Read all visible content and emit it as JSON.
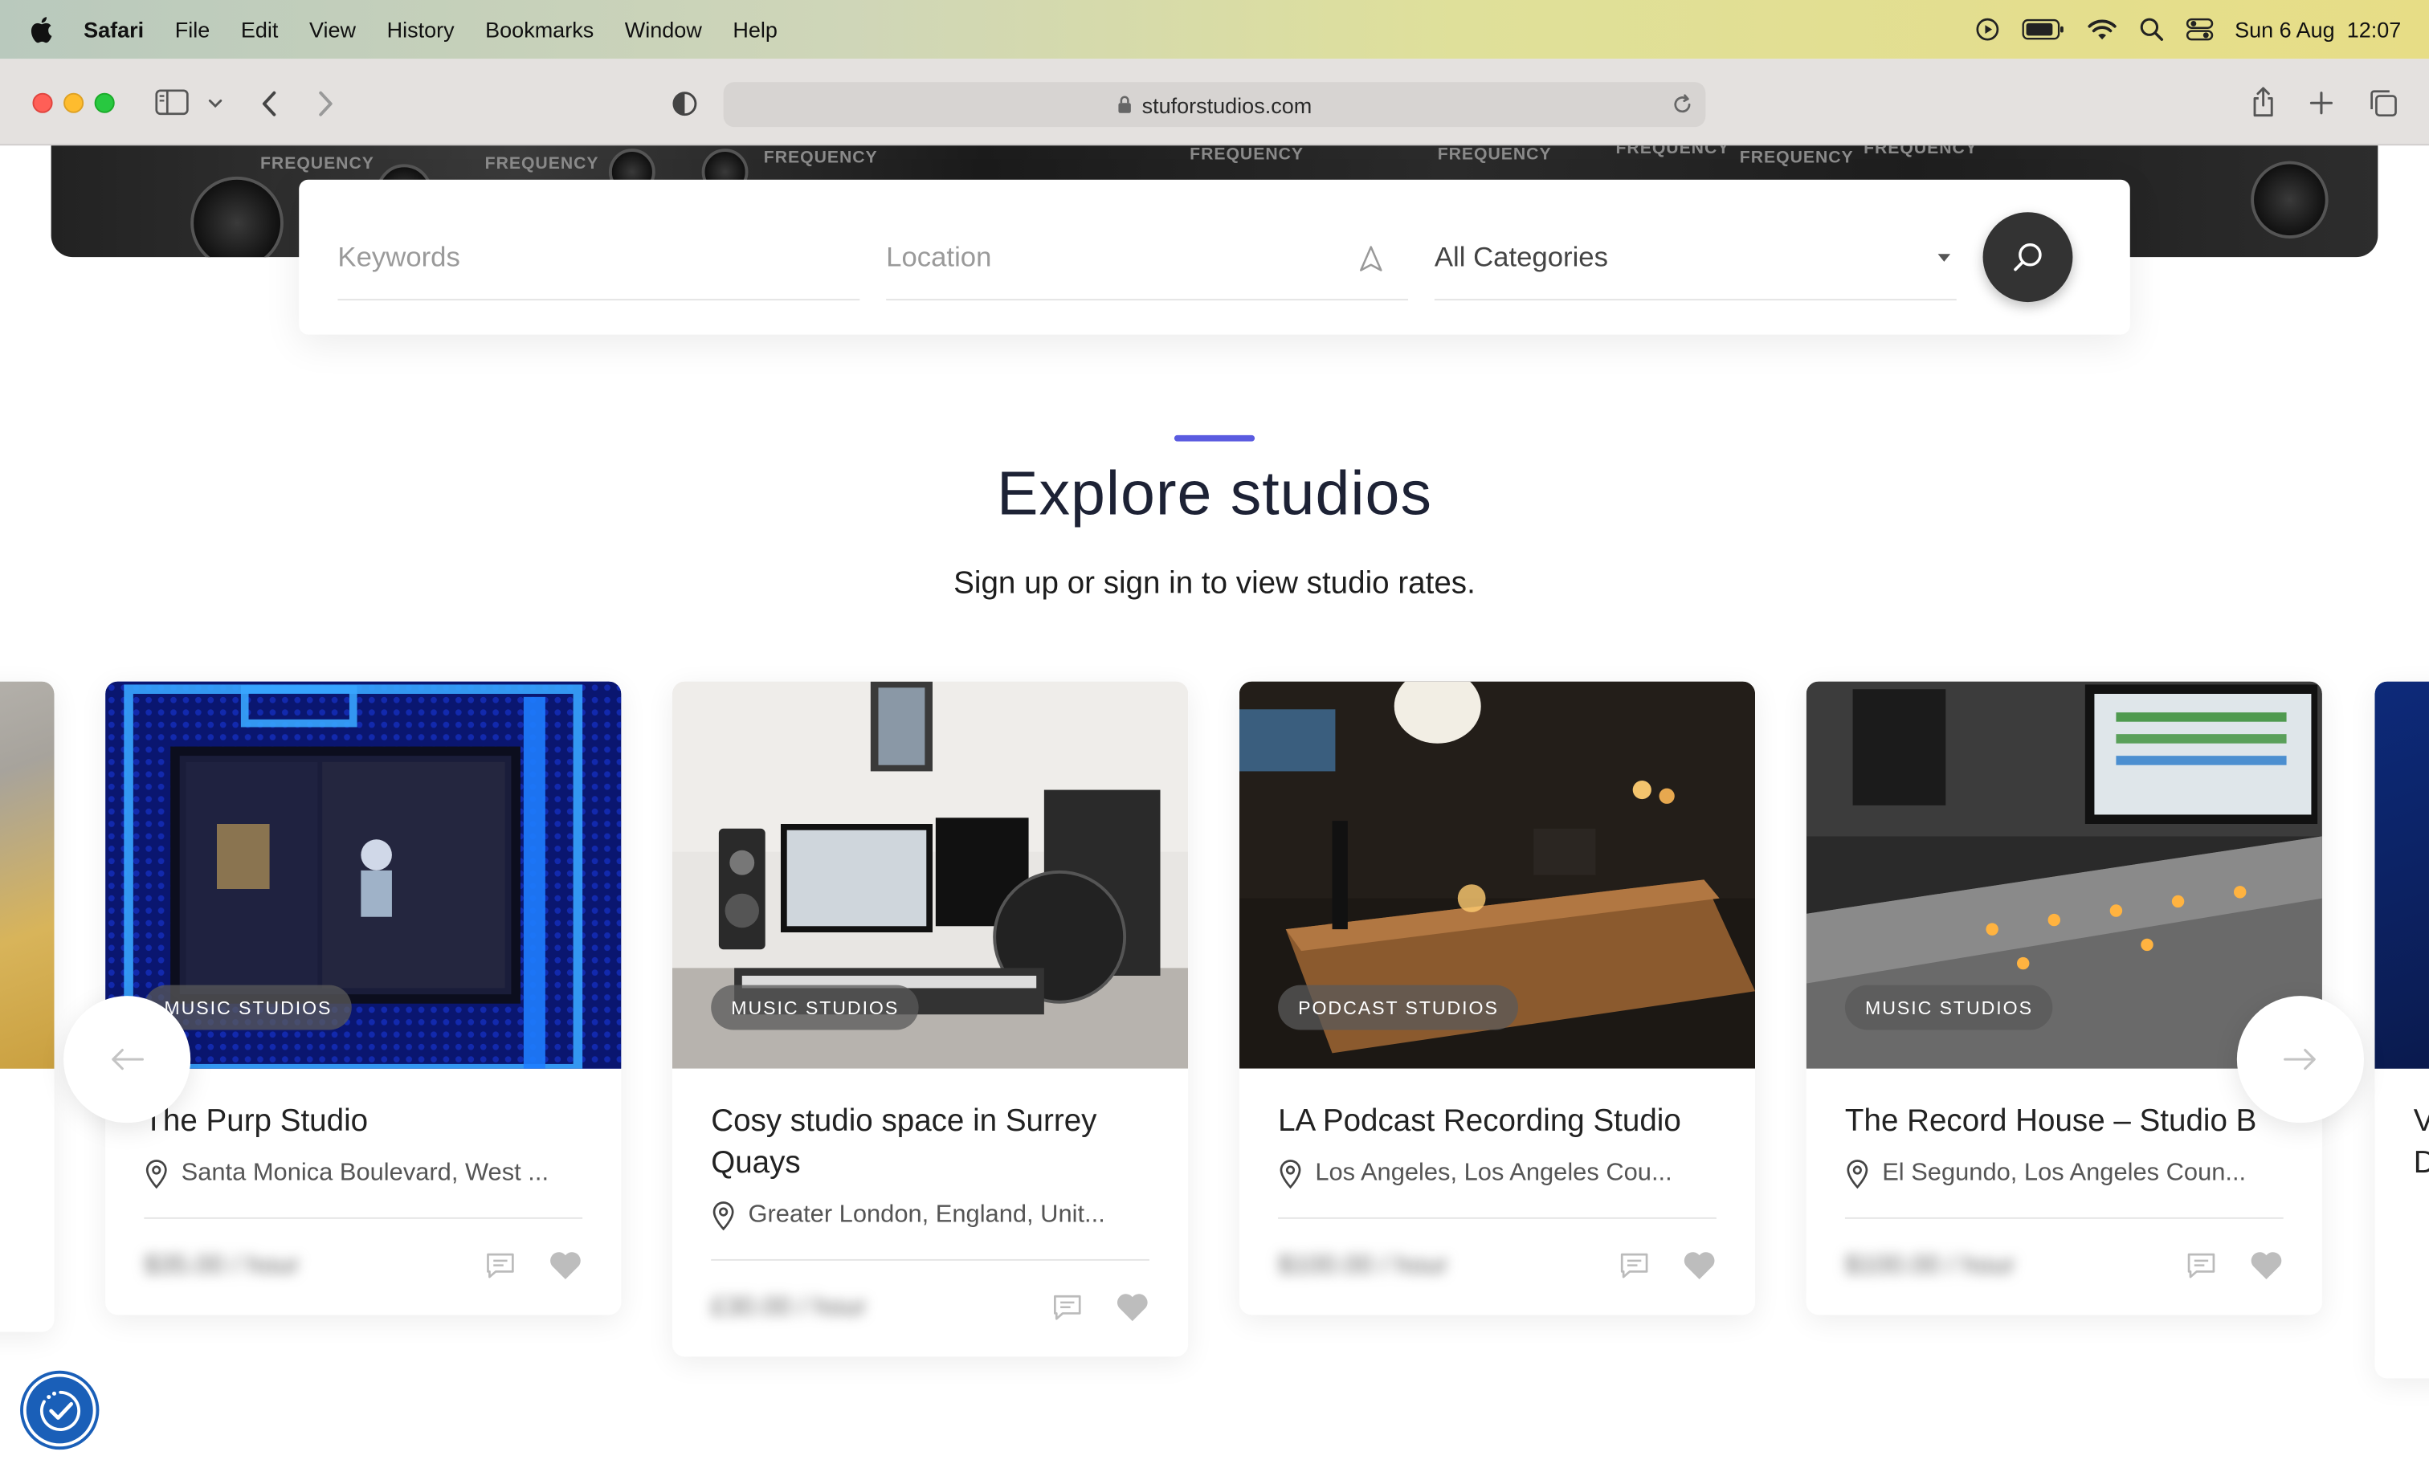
{
  "menubar": {
    "app": "Safari",
    "items": [
      "File",
      "Edit",
      "View",
      "History",
      "Bookmarks",
      "Window",
      "Help"
    ],
    "datetime": "Sun 6 Aug  12:07"
  },
  "browser": {
    "url": "stuforstudios.com"
  },
  "hero": {
    "labels": [
      "FREQUENCY",
      "FREQUENCY",
      "FREQUENCY",
      "FREQUENCY",
      "FREQUENCY",
      "FREQUENCY",
      "FREQUENCY",
      "FREQUENCY"
    ]
  },
  "search": {
    "keywords_placeholder": "Keywords",
    "location_placeholder": "Location",
    "category_value": "All Categories"
  },
  "section": {
    "title": "Explore studios",
    "subtitle": "Sign up or sign in to view studio rates."
  },
  "cards": [
    {
      "badge": "MUSIC STUDIOS",
      "title": "The Purp Studio",
      "location": "Santa Monica Boulevard, West ...",
      "price": "$35.00 / hour"
    },
    {
      "badge": "MUSIC STUDIOS",
      "title": "Cosy studio space in Surrey Quays",
      "location": "Greater London, England, Unit...",
      "price": "£30.00 / hour"
    },
    {
      "badge": "PODCAST STUDIOS",
      "title": "LA Podcast Recording Studio",
      "location": "Los Angeles, Los Angeles Cou...",
      "price": "$100.00 / hour"
    },
    {
      "badge": "MUSIC STUDIOS",
      "title": "The Record House – Studio B",
      "location": "El Segundo, Los Angeles Coun...",
      "price": "$100.00 / hour"
    }
  ],
  "partial_right_card": {
    "title": "V\nD"
  },
  "colors": {
    "accent": "#5a5be0",
    "search_button": "#333333",
    "accessibility": "#1a5fb8"
  }
}
